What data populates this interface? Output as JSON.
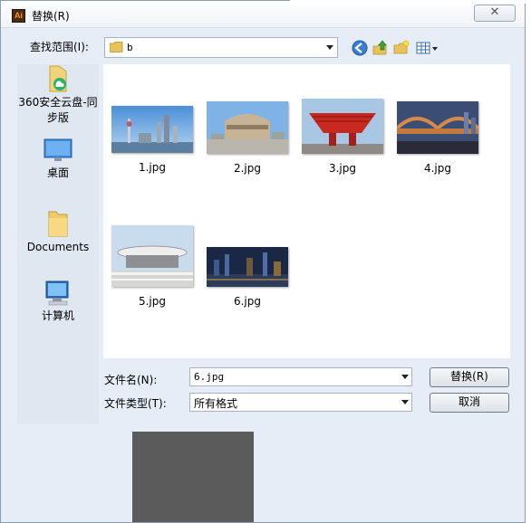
{
  "window": {
    "title": "替换(R)",
    "app_icon_text": "Ai",
    "close_glyph": "✕"
  },
  "lookin": {
    "label": "查找范围(I):",
    "value": "b"
  },
  "places": [
    {
      "label": "360安全云盘-同步版",
      "icon": "cloud-folder-icon"
    },
    {
      "label": "桌面",
      "icon": "desktop-icon"
    },
    {
      "label": "Documents",
      "icon": "folder-icon"
    },
    {
      "label": "计算机",
      "icon": "computer-icon"
    }
  ],
  "files": [
    {
      "name": "1.jpg"
    },
    {
      "name": "2.jpg"
    },
    {
      "name": "3.jpg"
    },
    {
      "name": "4.jpg"
    },
    {
      "name": "5.jpg"
    },
    {
      "name": "6.jpg"
    }
  ],
  "filename": {
    "label": "文件名(N):",
    "value": "6.jpg"
  },
  "filetype": {
    "label": "文件类型(T):",
    "value": "所有格式"
  },
  "buttons": {
    "replace": "替换(R)",
    "cancel": "取消"
  },
  "colors": {
    "dialog_bg": "#e6edf6",
    "preview_bg": "#5b5b5b"
  }
}
